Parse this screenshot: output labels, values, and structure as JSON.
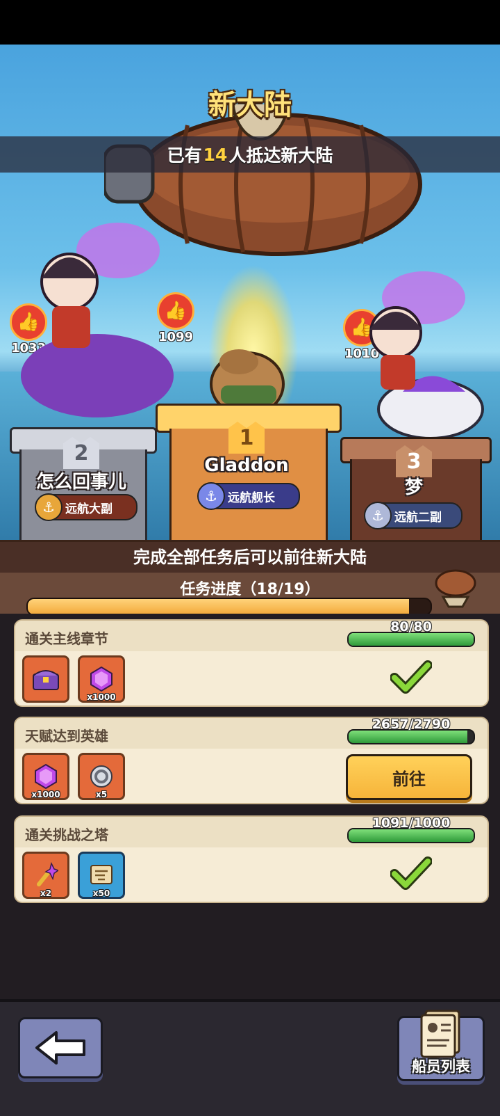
{
  "header": {
    "title": "新大陆",
    "arrival_prefix": "已有",
    "arrival_count": "14",
    "arrival_suffix": "人抵达新大陆"
  },
  "podiums": [
    {
      "rank": "2",
      "name": "怎么回事儿",
      "title": "远航大副",
      "likes": "1033",
      "accent": "#b8bcc8"
    },
    {
      "rank": "1",
      "name": "Gladdon",
      "title": "远航舰长",
      "likes": "1099",
      "accent": "#f2a93a"
    },
    {
      "rank": "3",
      "name": "梦",
      "title": "远航二副",
      "likes": "1010",
      "accent": "#a0684a"
    }
  ],
  "progress": {
    "hint": "完成全部任务后可以前往新大陆",
    "label": "任务进度（18/19）",
    "fraction": 0.947
  },
  "tasks": [
    {
      "title": "通关主线章节",
      "progress_text": "80/80",
      "fraction": 1.0,
      "status": "done",
      "rewards": [
        {
          "icon": "treasure-chest-icon",
          "qty": ""
        },
        {
          "icon": "purple-gem-icon",
          "qty": "x1000"
        }
      ]
    },
    {
      "title": "天赋达到英雄",
      "progress_text": "2657/2790",
      "fraction": 0.952,
      "status": "go",
      "button": "前往",
      "rewards": [
        {
          "icon": "purple-gem-icon",
          "qty": "x1000"
        },
        {
          "icon": "silver-coin-icon",
          "qty": "x5"
        }
      ]
    },
    {
      "title": "通关挑战之塔",
      "progress_text": "1091/1000",
      "fraction": 1.0,
      "status": "done",
      "rewards": [
        {
          "icon": "magic-wand-icon",
          "qty": "x2"
        },
        {
          "icon": "scroll-map-icon",
          "qty": "x50"
        }
      ]
    }
  ],
  "footer": {
    "crew_list_label": "船员列表"
  }
}
